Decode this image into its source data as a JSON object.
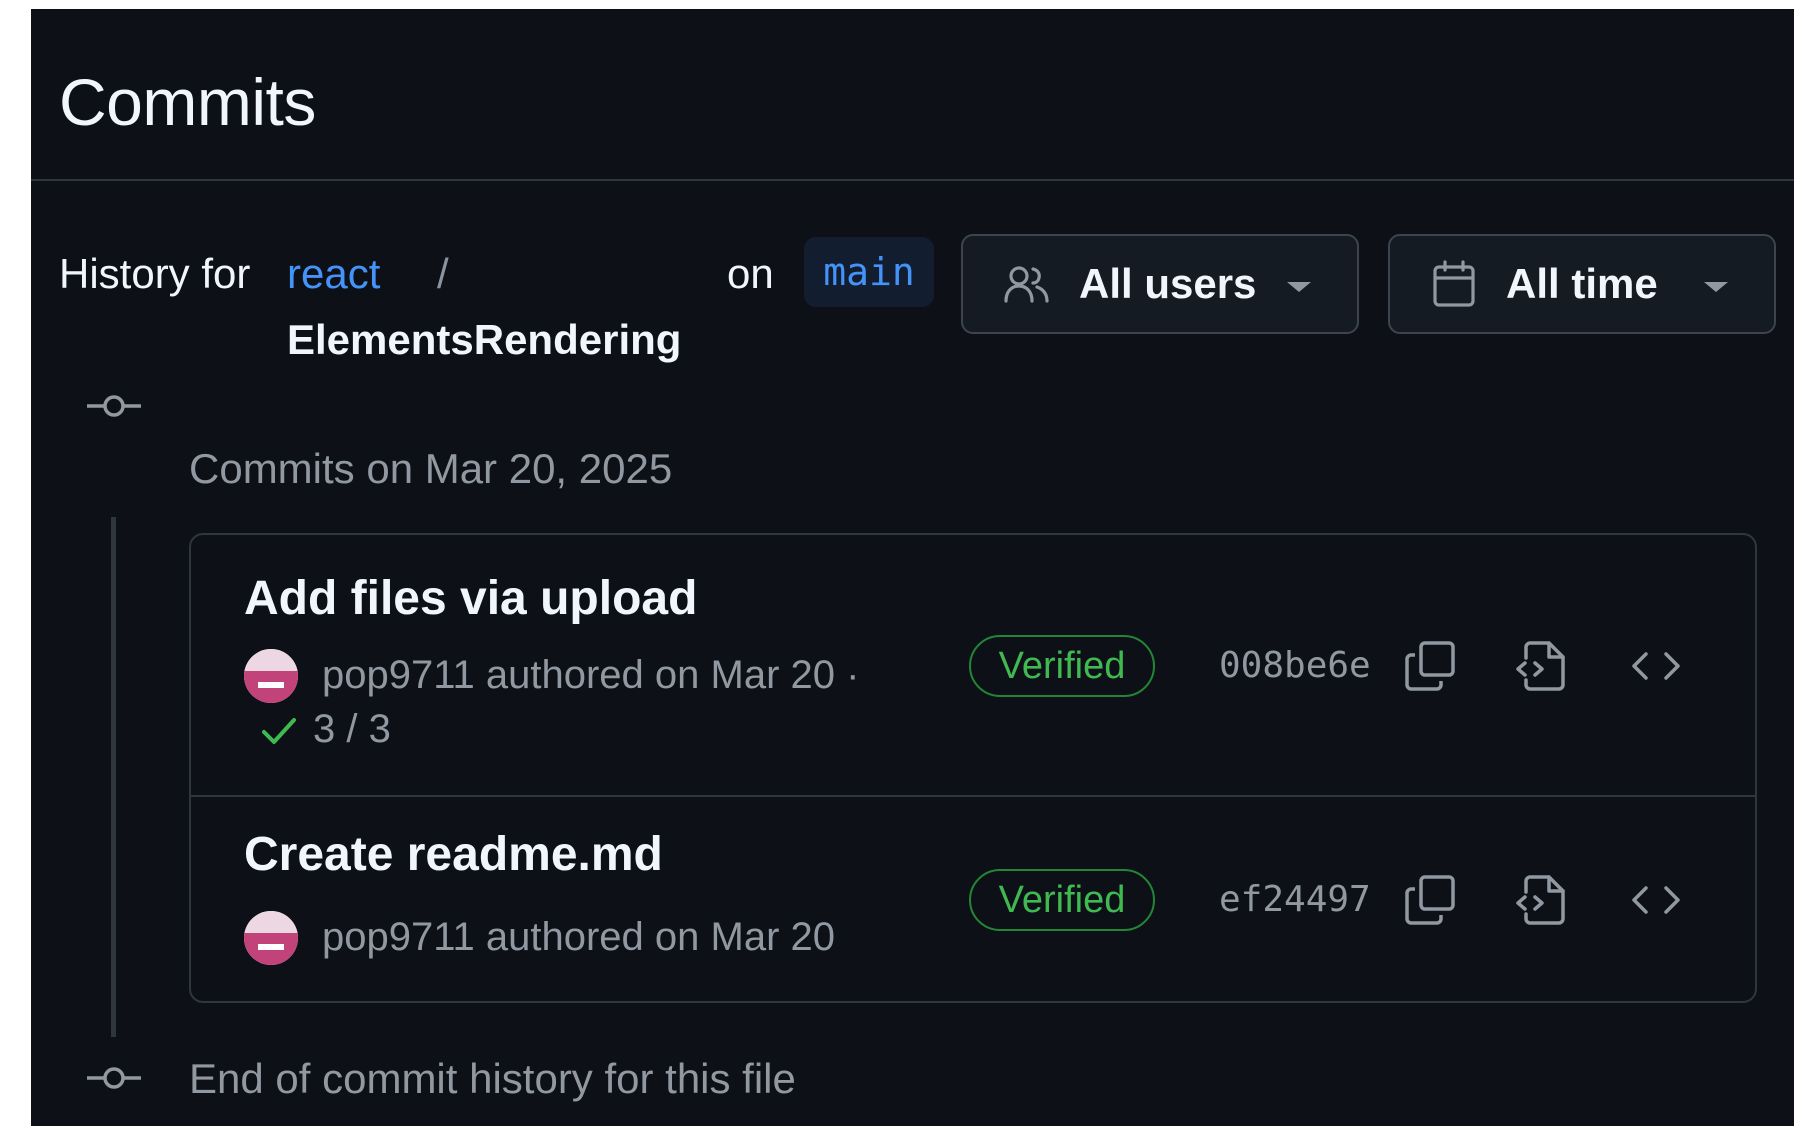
{
  "page": {
    "title": "Commits"
  },
  "history": {
    "prefix": "History for",
    "repo": "react",
    "separator": "/",
    "file": "ElementsRendering",
    "on_label": "on",
    "branch": "main"
  },
  "filters": {
    "users": {
      "label": "All users",
      "icon": "people-icon"
    },
    "time": {
      "label": "All time",
      "icon": "calendar-icon"
    }
  },
  "timeline": {
    "group_heading": "Commits on Mar 20, 2025",
    "end_text": "End of commit history for this file"
  },
  "commits": [
    {
      "title": "Add files via upload",
      "author": "pop9711",
      "authored_text": "authored on Mar 20 ·",
      "checks": "3 / 3",
      "verified": "Verified",
      "sha": "008be6e"
    },
    {
      "title": "Create readme.md",
      "author": "pop9711",
      "authored_text": "authored on Mar 20",
      "verified": "Verified",
      "sha": "ef24497"
    }
  ],
  "colors": {
    "background": "#0d1117",
    "link": "#4493f8",
    "verified": "#3fb950",
    "avatar": "#c2427a"
  }
}
